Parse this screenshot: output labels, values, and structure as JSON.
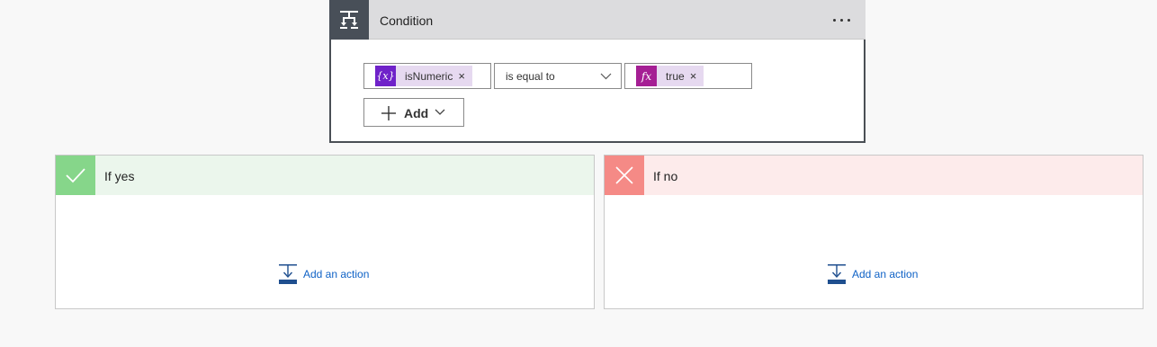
{
  "condition": {
    "title": "Condition",
    "left_operand": {
      "icon": "variable-icon",
      "icon_text": "{x}",
      "label": "isNumeric",
      "remove": "×"
    },
    "operator": "is equal to",
    "right_operand": {
      "icon": "function-icon",
      "icon_text": "fx",
      "label": "true",
      "remove": "×"
    },
    "add_label": "Add"
  },
  "branches": {
    "yes": {
      "title": "If yes",
      "add_action": "Add an action",
      "header_color": "#ebf6ec",
      "icon_color": "#86d68a"
    },
    "no": {
      "title": "If no",
      "add_action": "Add an action",
      "header_color": "#fdebeb",
      "icon_color": "#f58a86"
    }
  },
  "colors": {
    "variable_token": "#6f22c9",
    "function_token": "#a51f94",
    "token_bg": "#e6d9f0",
    "link": "#0f62c6"
  }
}
